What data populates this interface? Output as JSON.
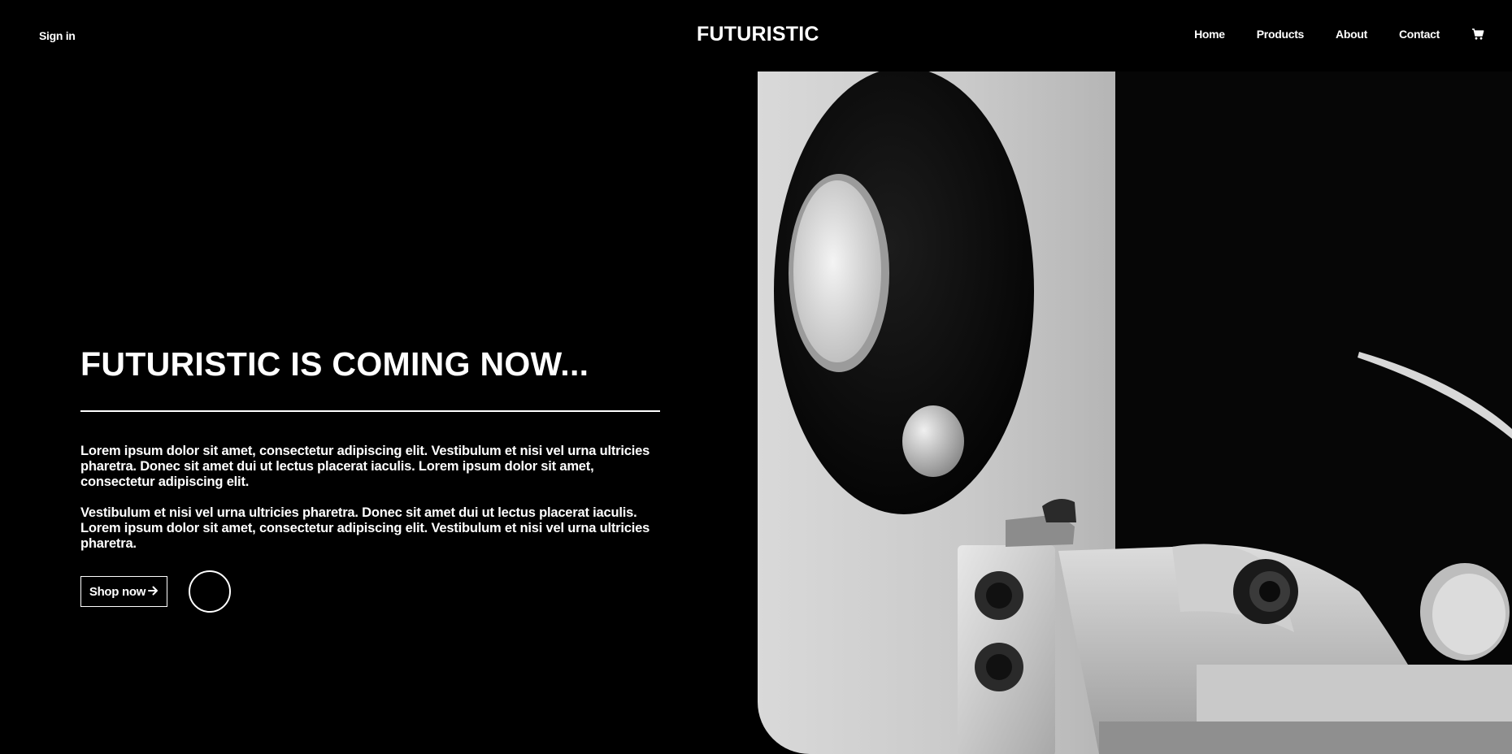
{
  "header": {
    "sign_in": "Sign in",
    "brand": "FUTURISTIC",
    "nav": [
      {
        "label": "Home"
      },
      {
        "label": "Products"
      },
      {
        "label": "About"
      },
      {
        "label": "Contact"
      }
    ],
    "cart_icon": "shopping-cart-icon"
  },
  "hero": {
    "title": "FUTURISTIC IS COMING NOW...",
    "paragraphs": [
      "Lorem ipsum dolor sit amet, consectetur adipiscing elit. Vestibulum et nisi vel urna ultricies pharetra. Donec sit amet dui ut lectus placerat iaculis. Lorem ipsum dolor sit amet, consectetur adipiscing elit.",
      "Vestibulum et nisi vel urna ultricies pharetra. Donec sit amet dui ut lectus placerat iaculis. Lorem ipsum dolor sit amet, consectetur adipiscing elit. Vestibulum et nisi vel urna ultricies pharetra."
    ],
    "shop_button": "Shop now",
    "shop_button_icon": "arrow-right-icon",
    "secondary_button_icon": "circle-icon"
  },
  "theme": {
    "background": "#000000",
    "text": "#ffffff"
  }
}
